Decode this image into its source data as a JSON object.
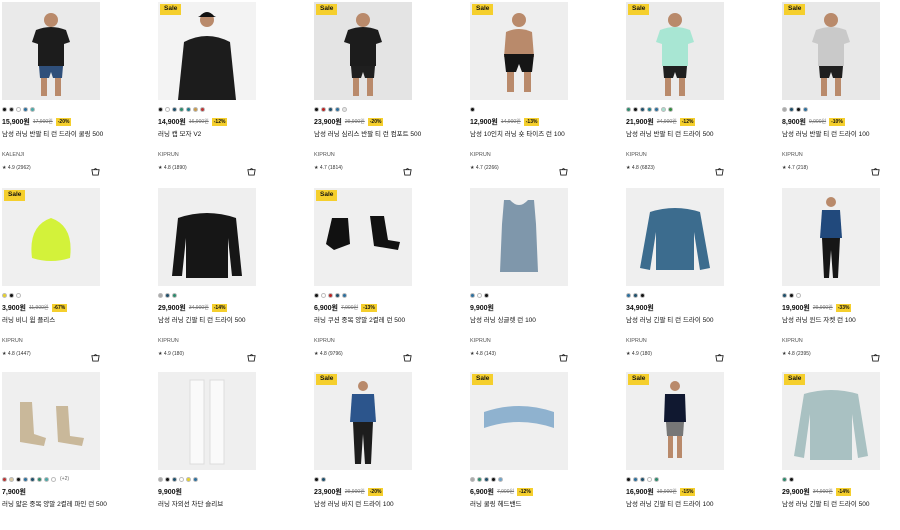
{
  "sale_label": "Sale",
  "products": [
    {
      "sale": false,
      "colors": [
        "#111",
        "#222",
        "#fff",
        "#2c6f9e",
        "#4aa9a8"
      ],
      "more": "",
      "price": "15,900원",
      "old": "17,900원",
      "disc": "-20%",
      "name": "남성 러닝 반팔 티 런 드라이 쿨링 500",
      "brand": "KALENJI",
      "rating": "★ 4.9 (2962)",
      "img": "#eaeaea"
    },
    {
      "sale": true,
      "colors": [
        "#111",
        "#fff",
        "#1d4e6b",
        "#2c8a6c",
        "#1d7c8a",
        "#c99a4a",
        "#b33"
      ],
      "more": "",
      "price": "14,900원",
      "old": "16,900원",
      "disc": "-12%",
      "name": "러닝 캡 모자 V2",
      "brand": "KIPRUN",
      "rating": "★ 4.8 (1890)",
      "img": "#f3f3f3"
    },
    {
      "sale": true,
      "colors": [
        "#111",
        "#b22",
        "#1d4e6b",
        "#2c6f9e",
        "#e6e6e6"
      ],
      "more": "",
      "price": "23,900원",
      "old": "29,900원",
      "disc": "-20%",
      "name": "남성 러닝 심리스 반팔 티 런 컴포트 500",
      "brand": "KIPRUN",
      "rating": "★ 4.7 (1814)",
      "img": "#e4e4e4"
    },
    {
      "sale": true,
      "colors": [
        "#111"
      ],
      "more": "",
      "price": "12,900원",
      "old": "14,900원",
      "disc": "-13%",
      "name": "남성 10인치 러닝 숏 타이즈 런 100",
      "brand": "KIPRUN",
      "rating": "★ 4.7 (2266)",
      "img": "#eeeeee"
    },
    {
      "sale": true,
      "colors": [
        "#2c8a6c",
        "#111",
        "#1d4e6b",
        "#1d7c8a",
        "#2c6f9e",
        "#a8e0cf",
        "#2f8a3d"
      ],
      "more": "",
      "price": "21,900원",
      "old": "24,900원",
      "disc": "-12%",
      "name": "남성 러닝 반팔 티 런 드라이 500",
      "brand": "KIPRUN",
      "rating": "★ 4.8 (6823)",
      "img": "#ebebeb"
    },
    {
      "sale": true,
      "colors": [
        "#aaa",
        "#1d4e6b",
        "#111",
        "#2c6f9e"
      ],
      "more": "",
      "price": "8,900원",
      "old": "9,900원",
      "disc": "-10%",
      "name": "남성 러닝 반팔 티 런 드라이 100",
      "brand": "KIPRUN",
      "rating": "★ 4.7 (218)",
      "img": "#e8e8e8"
    },
    {
      "sale": true,
      "colors": [
        "#e7d22a",
        "#111",
        "#fff"
      ],
      "more": "",
      "price": "3,900원",
      "old": "11,900원",
      "disc": "-67%",
      "name": "러닝 비니 윔 플리스",
      "brand": "KIPRUN",
      "rating": "★ 4.8 (1447)",
      "img": "#efefef"
    },
    {
      "sale": false,
      "colors": [
        "#aaa",
        "#1d4e6b",
        "#2c8a6c"
      ],
      "more": "",
      "price": "29,900원",
      "old": "34,900원",
      "disc": "-14%",
      "name": "남성 러닝 긴팔 티 런 드라이 500",
      "brand": "KIPRUN",
      "rating": "★ 4.9 (180)",
      "img": "#efefef"
    },
    {
      "sale": true,
      "colors": [
        "#111",
        "#fff",
        "#b22",
        "#1d4e6b",
        "#2c6f9e"
      ],
      "more": "",
      "price": "6,900원",
      "old": "7,900원",
      "disc": "-13%",
      "name": "러닝 쿠션 중목 양말 2켤레 런 500",
      "brand": "KIPRUN",
      "rating": "★ 4.8 (9796)",
      "img": "#efefef"
    },
    {
      "sale": false,
      "colors": [
        "#2c6f9e",
        "#fff",
        "#111"
      ],
      "more": "",
      "price": "9,900원",
      "old": "",
      "disc": "",
      "name": "남성 러닝 싱글렛 런 100",
      "brand": "KIPRUN",
      "rating": "★ 4.8 (143)",
      "img": "#efefef"
    },
    {
      "sale": false,
      "colors": [
        "#2c6f9e",
        "#1d4e6b",
        "#111"
      ],
      "more": "",
      "price": "34,900원",
      "old": "",
      "disc": "",
      "name": "남성 러닝 긴팔 티 런 드라이 500",
      "brand": "KIPRUN",
      "rating": "★ 4.9 (180)",
      "img": "#efefef"
    },
    {
      "sale": false,
      "colors": [
        "#1d4e6b",
        "#111",
        "#fff"
      ],
      "more": "",
      "price": "19,900원",
      "old": "29,900원",
      "disc": "-33%",
      "name": "남성 러닝 윈드 자켓 런 100",
      "brand": "KIPRUN",
      "rating": "★ 4.8 (2395)",
      "img": "#efefef"
    },
    {
      "sale": false,
      "colors": [
        "#b33",
        "#d9c9a3",
        "#111",
        "#2c6f9e",
        "#1d4e6b",
        "#2c8a6c",
        "#4aa9a8",
        "#fff"
      ],
      "more": "(+2)",
      "price": "7,900원",
      "old": "",
      "disc": "",
      "name": "러닝 얇은 중목 양말 2켤레 파인 런 500",
      "brand": "",
      "rating": "",
      "img": "#efefef"
    },
    {
      "sale": false,
      "colors": [
        "#aaa",
        "#111",
        "#1d4e6b",
        "#fff",
        "#e7d22a",
        "#2c6f9e"
      ],
      "more": "",
      "price": "9,900원",
      "old": "",
      "disc": "",
      "name": "러닝 자외선 차단 슬리브",
      "brand": "",
      "rating": "",
      "img": "#efefef"
    },
    {
      "sale": true,
      "colors": [
        "#111",
        "#1d4e6b"
      ],
      "more": "",
      "price": "23,900원",
      "old": "29,900원",
      "disc": "-20%",
      "name": "남성 러닝 바지 런 드라이 100",
      "brand": "",
      "rating": "",
      "img": "#efefef"
    },
    {
      "sale": true,
      "colors": [
        "#aaa",
        "#2c8a6c",
        "#1d4e6b",
        "#111",
        "#6fa3c9"
      ],
      "more": "",
      "price": "6,900원",
      "old": "7,900원",
      "disc": "-12%",
      "name": "러닝 쿨링 헤드밴드",
      "brand": "",
      "rating": "",
      "img": "#efefef"
    },
    {
      "sale": true,
      "colors": [
        "#111",
        "#2c6f9e",
        "#1d4e6b",
        "#fff",
        "#2c8a6c"
      ],
      "more": "",
      "price": "16,900원",
      "old": "19,900원",
      "disc": "-15%",
      "name": "남성 러닝 긴팔 티 런 드라이 100",
      "brand": "",
      "rating": "",
      "img": "#efefef"
    },
    {
      "sale": true,
      "colors": [
        "#2c8a6c",
        "#111"
      ],
      "more": "",
      "price": "29,900원",
      "old": "34,900원",
      "disc": "-14%",
      "name": "남성 러닝 긴팔 티 런 드라이 500",
      "brand": "",
      "rating": "",
      "img": "#efefef"
    }
  ]
}
